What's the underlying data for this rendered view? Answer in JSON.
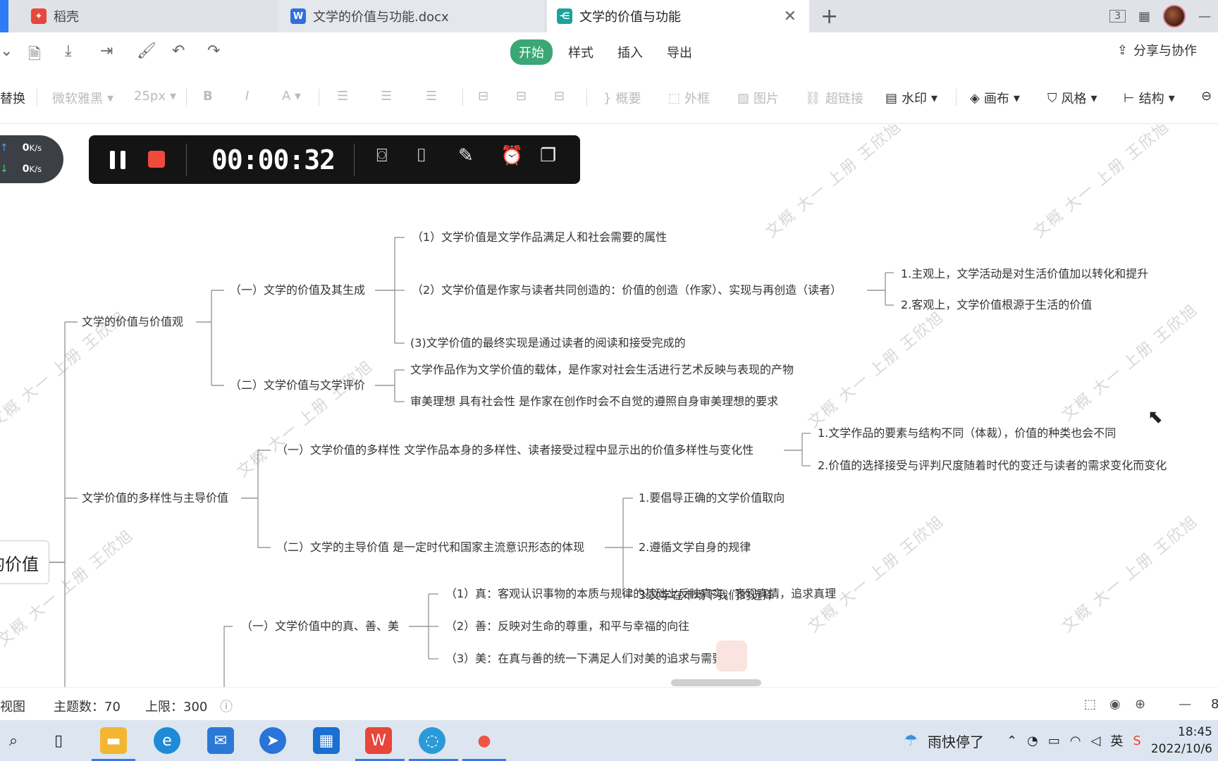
{
  "tabs": [
    {
      "label": "稻壳"
    },
    {
      "label": "文学的价值与功能.docx"
    },
    {
      "label": "文学的价值与功能"
    }
  ],
  "window": {
    "layout_label": "3"
  },
  "ribbon": {
    "tabs": [
      "开始",
      "样式",
      "插入",
      "导出"
    ],
    "share_label": "分享与协作"
  },
  "format_bar": {
    "replace": "替换",
    "font": "微软雅黑",
    "size": "25px",
    "summary": "概要",
    "frame": "外框",
    "image": "图片",
    "link": "超链接",
    "watermark": "水印",
    "canvas": "画布",
    "style": "风格",
    "structure": "结构"
  },
  "recorder": {
    "timer": "00:00:32",
    "upload": "0",
    "download": "0",
    "unit": "K/s"
  },
  "mindmap": {
    "root": "的价值",
    "b1": {
      "label": "文学的价值与价值观",
      "c1": {
        "label": "（一）文学的价值及其生成",
        "items": [
          "（1）文学价值是文学作品满足人和社会需要的属性",
          "（2）文学价值是作家与读者共同创造的：价值的创造（作家）、实现与再创造（读者）",
          "(3)文学价值的最终实现是通过读者的阅读和接受完成的"
        ],
        "sub": [
          "1.主观上，文学活动是对生活价值加以转化和提升",
          "2.客观上，文学价值根源于生活的价值"
        ]
      },
      "c2": {
        "label": "（二）文学价值与文学评价",
        "items": [
          "文学作品作为文学价值的载体，是作家对社会生活进行艺术反映与表现的产物",
          "审美理想  具有社会性   是作家在创作时会不自觉的遵照自身审美理想的要求"
        ]
      }
    },
    "b2": {
      "label": "文学价值的多样性与主导价值",
      "c1": {
        "label": "（一）文学价值的多样性   文学作品本身的多样性、读者接受过程中显示出的价值多样性与变化性",
        "items": [
          "1.文学作品的要素与结构不同（体裁），价值的种类也会不同",
          "2.价值的选择接受与评判尺度随着时代的变迁与读者的需求变化而变化"
        ]
      },
      "c2": {
        "label": "（二）文学的主导价值  是一定时代和国家主流意识形态的体现",
        "items": [
          "1.要倡导正确的文学价值取向",
          "2.遵循文学自身的规律",
          "3.文学在市场下我们的选择"
        ]
      }
    },
    "b3": {
      "c1": {
        "label": "（一）文学价值中的真、善、美",
        "items": [
          "（1）真：客观认识事物的本质与规律的基础上反映真实，表现真情，追求真理",
          "（2）善：反映对生命的尊重，和平与幸福的向往",
          "（3）美：在真与善的统一下满足人们对美的追求与需要"
        ]
      }
    }
  },
  "watermark_text": "文概 大一 上册 王欣旭",
  "status": {
    "view": "视图",
    "topics": "主题数：70",
    "limit": "上限：300",
    "zoom_partial": "8"
  },
  "taskbar": {
    "weather": "雨快停了",
    "ime": "英",
    "time": "18:45",
    "date": "2022/10/6"
  }
}
